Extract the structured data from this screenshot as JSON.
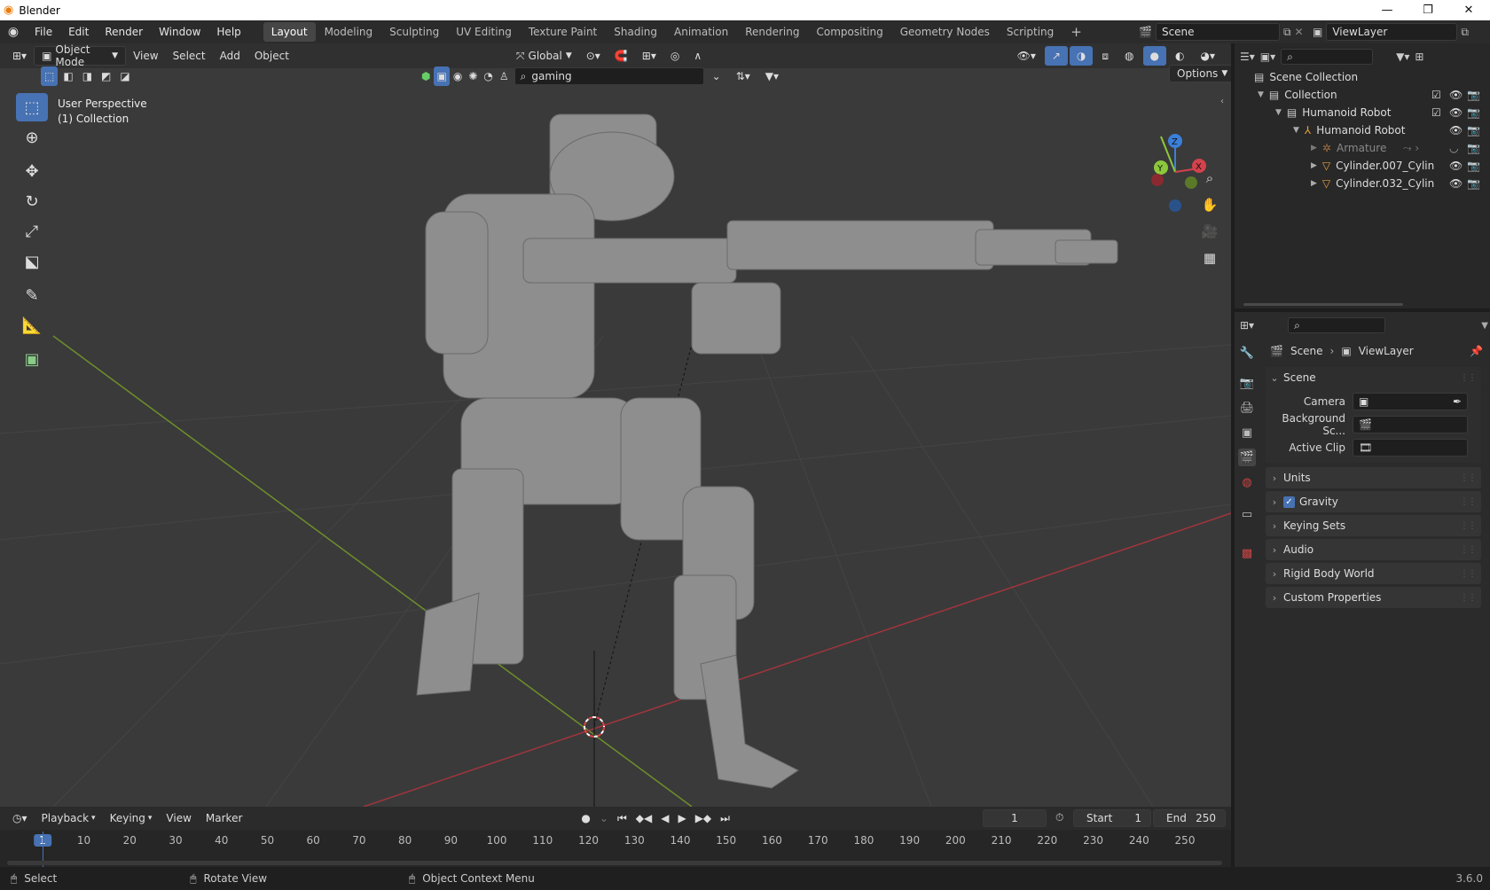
{
  "app": {
    "title": "Blender",
    "version": "3.6.0"
  },
  "menus": [
    "File",
    "Edit",
    "Render",
    "Window",
    "Help"
  ],
  "workspaces": [
    {
      "label": "Layout",
      "active": true
    },
    {
      "label": "Modeling"
    },
    {
      "label": "Sculpting"
    },
    {
      "label": "UV Editing"
    },
    {
      "label": "Texture Paint"
    },
    {
      "label": "Shading"
    },
    {
      "label": "Animation"
    },
    {
      "label": "Rendering"
    },
    {
      "label": "Compositing"
    },
    {
      "label": "Geometry Nodes"
    },
    {
      "label": "Scripting"
    }
  ],
  "scene_selector": {
    "value": "Scene"
  },
  "viewlayer_selector": {
    "value": "ViewLayer"
  },
  "viewport_header": {
    "mode": "Object Mode",
    "menus": [
      "View",
      "Select",
      "Add",
      "Object"
    ],
    "orientation": "Global",
    "search_value": "gaming",
    "options_label": "Options"
  },
  "viewport": {
    "perspective": "User Perspective",
    "collection": "(1) Collection"
  },
  "outliner": {
    "rows": [
      {
        "label": "Scene Collection",
        "icon": "scene-collection-icon"
      },
      {
        "label": "Collection",
        "icon": "collection-icon"
      },
      {
        "label": "Humanoid Robot",
        "icon": "collection-icon"
      },
      {
        "label": "Humanoid Robot",
        "icon": "armature-object-icon"
      },
      {
        "label": "Armature",
        "icon": "armature-data-icon"
      },
      {
        "label": "Cylinder.007_Cylin",
        "icon": "mesh-icon"
      },
      {
        "label": "Cylinder.032_Cylin",
        "icon": "mesh-icon"
      }
    ]
  },
  "properties": {
    "breadcrumb": [
      "Scene",
      "ViewLayer"
    ],
    "section": "Scene",
    "fields": [
      {
        "label": "Camera",
        "value": ""
      },
      {
        "label": "Background Sc...",
        "value": ""
      },
      {
        "label": "Active Clip",
        "value": ""
      }
    ],
    "panels": [
      "Units",
      "Gravity",
      "Keying Sets",
      "Audio",
      "Rigid Body World",
      "Custom Properties"
    ],
    "gravity_checked": true
  },
  "timeline": {
    "menus": [
      "Playback",
      "Keying",
      "View",
      "Marker"
    ],
    "current_frame": "1",
    "start_label": "Start",
    "start": "1",
    "end_label": "End",
    "end": "250",
    "ticks": [
      "1",
      "10",
      "20",
      "30",
      "40",
      "50",
      "60",
      "70",
      "80",
      "90",
      "100",
      "110",
      "120",
      "130",
      "140",
      "150",
      "160",
      "170",
      "180",
      "190",
      "200",
      "210",
      "220",
      "230",
      "240",
      "250"
    ]
  },
  "statusbar": {
    "select": "Select",
    "rotate": "Rotate View",
    "context": "Object Context Menu"
  },
  "colors": {
    "accent": "#4772b3",
    "x_axis": "#d3424c",
    "y_axis": "#8cc83c",
    "z_axis": "#3b7fd9",
    "viewport_bg": "#3a3a3a"
  }
}
